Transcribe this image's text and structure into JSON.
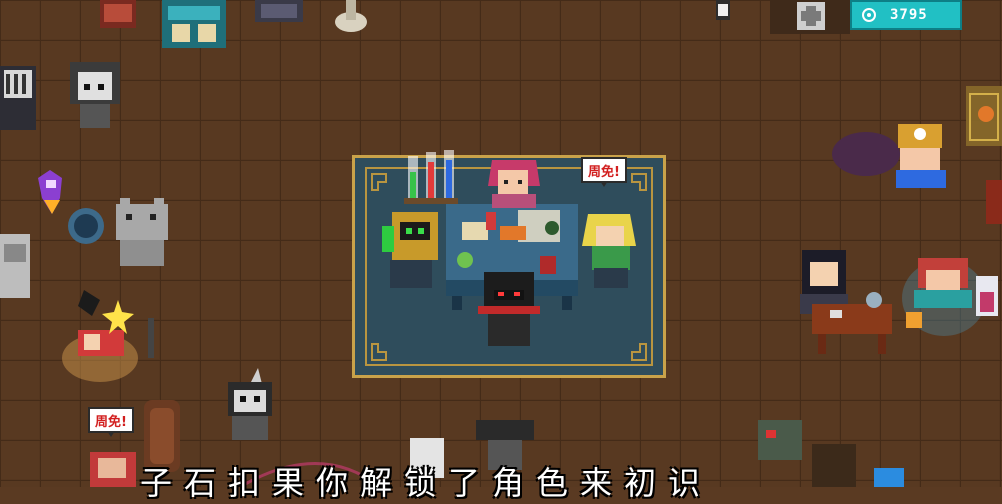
{
  "hud": {
    "gems_icon": "gem-icon",
    "gems_value": "3795"
  },
  "speech_bubbles": [
    {
      "text": "周免!"
    },
    {
      "text": "周免!"
    }
  ],
  "subtitle": {
    "text": "子石扣果你解锁了角色来初识"
  },
  "colors": {
    "floor": "#5a3a22",
    "rug": "#2f4d5c",
    "rug_border": "#c9a24a",
    "hud_bg": "#21c0c4",
    "bubble_text": "#d21f1f"
  }
}
